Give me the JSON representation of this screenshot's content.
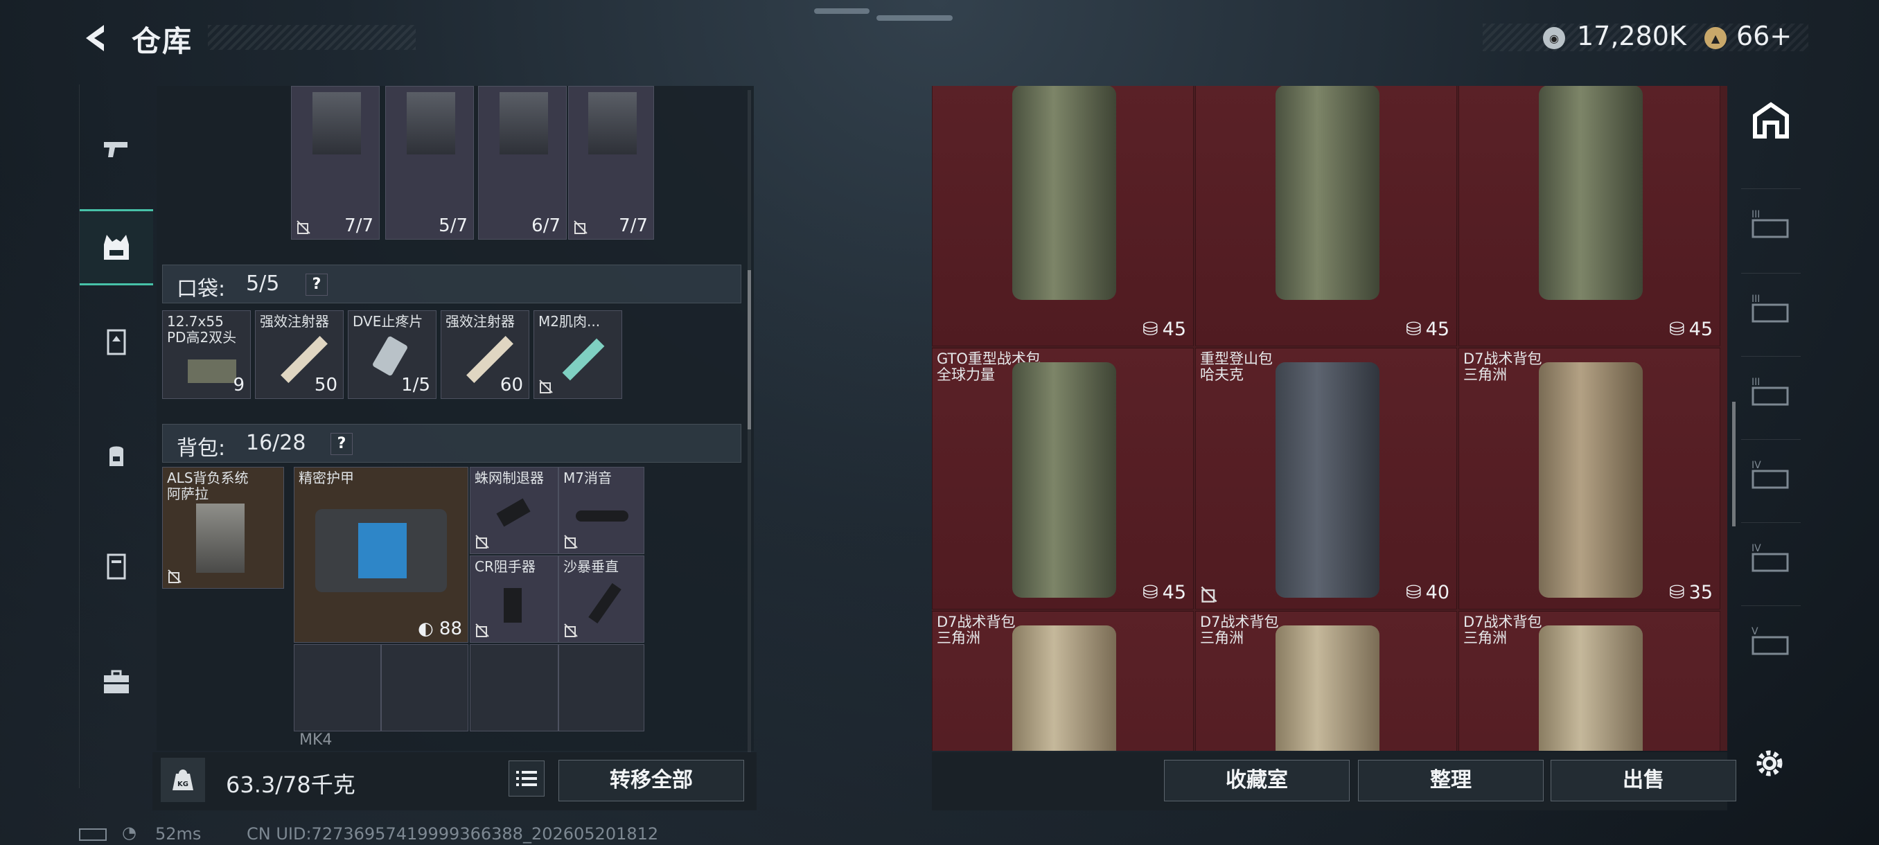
{
  "header": {
    "title": "仓库"
  },
  "currency": {
    "coins": "17,280K",
    "tickets": "66+"
  },
  "left_rail": [
    "weapon",
    "vest",
    "armor",
    "backpack",
    "container",
    "case"
  ],
  "left_panel": {
    "ammo_row": [
      "7/7",
      "5/7",
      "6/7",
      "7/7"
    ],
    "pockets": {
      "label": "口袋:",
      "count": "5/5"
    },
    "pocket_items": [
      {
        "label": "12.7x55\nPD高2双头",
        "count": "9"
      },
      {
        "label": "强效注射器",
        "count": "50"
      },
      {
        "label": "DVE止疼片",
        "count": "1/5"
      },
      {
        "label": "强效注射器",
        "count": "60"
      },
      {
        "label": "M2肌肉...",
        "count": ""
      }
    ],
    "backpack": {
      "label": "背包:",
      "count": "16/28"
    },
    "backpack_items": [
      {
        "label": "ALS背负系统\n阿萨拉",
        "count": ""
      },
      {
        "label": "精密护甲",
        "count": "88"
      },
      {
        "label": "蛛网制退器",
        "count": ""
      },
      {
        "label": "M7消音",
        "count": ""
      },
      {
        "label": "CR阻手器",
        "count": ""
      },
      {
        "label": "沙暴垂直",
        "count": ""
      }
    ],
    "mk4_label": "MK4"
  },
  "weight": {
    "value": "63.3/78千克"
  },
  "transfer_all": "转移全部",
  "grid": [
    {
      "label": "",
      "count": "45",
      "color": "#7d8568"
    },
    {
      "label": "",
      "count": "45",
      "color": "#7d8568"
    },
    {
      "label": "",
      "count": "45",
      "color": "#7d8568"
    },
    {
      "label": "GTO重型战术包\n全球力量",
      "count": "45",
      "color": "#7d8568"
    },
    {
      "label": "重型登山包\n哈夫克",
      "count": "40",
      "color": "#5d6470"
    },
    {
      "label": "D7战术背包\n三角洲",
      "count": "35",
      "color": "#b3a184"
    },
    {
      "label": "D7战术背包\n三角洲",
      "count": "",
      "color": "#c5b89b"
    },
    {
      "label": "D7战术背包\n三角洲",
      "count": "",
      "color": "#c5b89b"
    },
    {
      "label": "D7战术背包\n三角洲",
      "count": "",
      "color": "#c5b89b"
    }
  ],
  "right_rail": [
    "stash-home",
    "tier-III-a",
    "tier-III-b",
    "tier-III-c",
    "tier-IV-a",
    "tier-IV-b",
    "tier-V"
  ],
  "buttons": {
    "collection": "收藏室",
    "organize": "整理",
    "sell": "出售"
  },
  "status": {
    "ping": "52ms",
    "uid": "CN UID:72736957419999366388_202605201812"
  }
}
